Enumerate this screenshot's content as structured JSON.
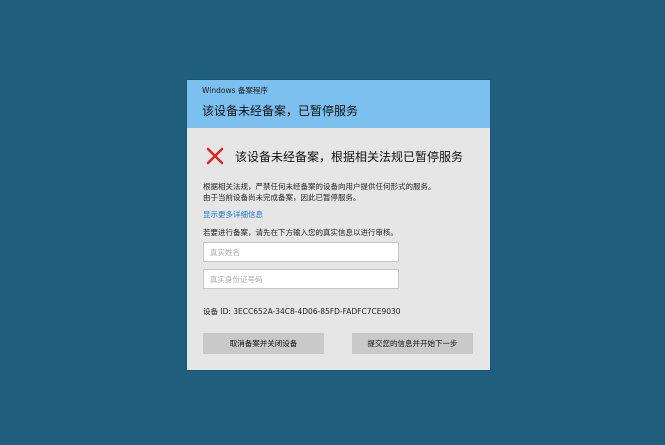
{
  "dialog": {
    "app_name": "Windows 备案程序",
    "header_title": "该设备未经备案，已暂停服务",
    "error_title": "该设备未经备案，根据相关法规已暂停服务",
    "description_lines": [
      "根据相关法规，严禁任何未经备案的设备向用户提供任何形式的服务。",
      "由于当前设备尚未完成备案，因此已暂停服务。"
    ],
    "more_info_link": "显示更多详细信息",
    "instruction": "若要进行备案，请先在下方输入您的真实信息以进行审核。",
    "name_field": {
      "value": "",
      "placeholder": "真实姓名"
    },
    "id_field": {
      "value": "",
      "placeholder": "真实身份证号码"
    },
    "device_id": "设备 ID: 3ECC652A-34C8-4D06-85FD-FADFC7CE9030",
    "cancel_button": "取消备案并关闭设备",
    "submit_button": "提交您的信息并开始下一步"
  },
  "icons": {
    "error": "close-x-icon"
  },
  "colors": {
    "desktop_background": "#1f5f7d",
    "header_background": "#7cc0f0",
    "dialog_background": "#e6e6e6",
    "error_icon": "#d62b2b",
    "link": "#1979c9",
    "button": "#c9c9c9"
  }
}
